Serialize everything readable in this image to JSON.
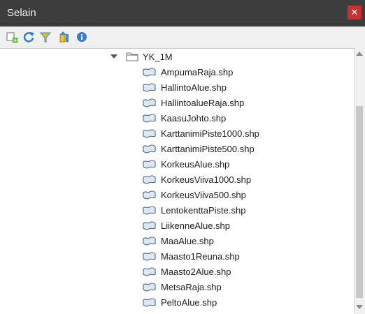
{
  "window": {
    "title": "Selain",
    "close_label": "✕"
  },
  "toolbar": {
    "buttons": [
      {
        "name": "add-layer-button",
        "icon": "add-layer-icon"
      },
      {
        "name": "refresh-button",
        "icon": "refresh-icon"
      },
      {
        "name": "filter-button",
        "icon": "filter-icon"
      },
      {
        "name": "collapse-all-button",
        "icon": "collapse-all-icon"
      },
      {
        "name": "properties-button",
        "icon": "info-icon"
      }
    ]
  },
  "tree": {
    "folder": {
      "label": "YK_1M",
      "icon": "folder-icon",
      "expanded": true
    },
    "files": [
      "AmpumaRaja.shp",
      "HallintoAlue.shp",
      "HallintoalueRaja.shp",
      "KaasuJohto.shp",
      "KarttanimiPiste1000.shp",
      "KarttanimiPiste500.shp",
      "KorkeusAlue.shp",
      "KorkeusViiva1000.shp",
      "KorkeusViiva500.shp",
      "LentokenttaPiste.shp",
      "LiikenneAlue.shp",
      "MaaAlue.shp",
      "Maasto1Reuna.shp",
      "Maasto2Alue.shp",
      "MetsaRaja.shp",
      "PeltoAlue.shp"
    ]
  }
}
